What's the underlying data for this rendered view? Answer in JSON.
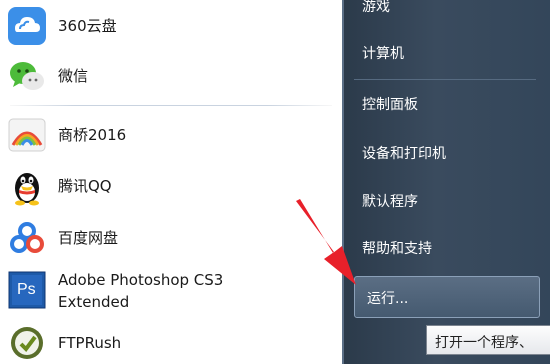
{
  "programs": [
    {
      "label": "360云盘",
      "icon": "360-cloud-icon"
    },
    {
      "label": "微信",
      "icon": "wechat-icon"
    },
    {
      "label": "商桥2016",
      "icon": "shangqiao-icon"
    },
    {
      "label": "腾讯QQ",
      "icon": "qq-penguin-icon"
    },
    {
      "label": "百度网盘",
      "icon": "baidu-netdisk-icon"
    },
    {
      "label": "Adobe Photoshop CS3",
      "label2": "Extended",
      "icon": "photoshop-icon",
      "icon_text": "Ps"
    },
    {
      "label": "FTPRush",
      "icon": "ftprush-icon"
    }
  ],
  "system": {
    "games": "游戏",
    "computer": "计算机",
    "control_panel": "控制面板",
    "devices_printers": "设备和打印机",
    "default_programs": "默认程序",
    "help_support": "帮助和支持",
    "run": "运行..."
  },
  "tooltip": "打开一个程序、",
  "colors": {
    "right_pane": "#3a4b5e",
    "arrow": "#e8202a",
    "ps_blue": "#1e5aa8",
    "qq_yellow": "#f6c21a",
    "baidu_blue": "#2f7de1",
    "wechat_green": "#4dbb3a"
  }
}
